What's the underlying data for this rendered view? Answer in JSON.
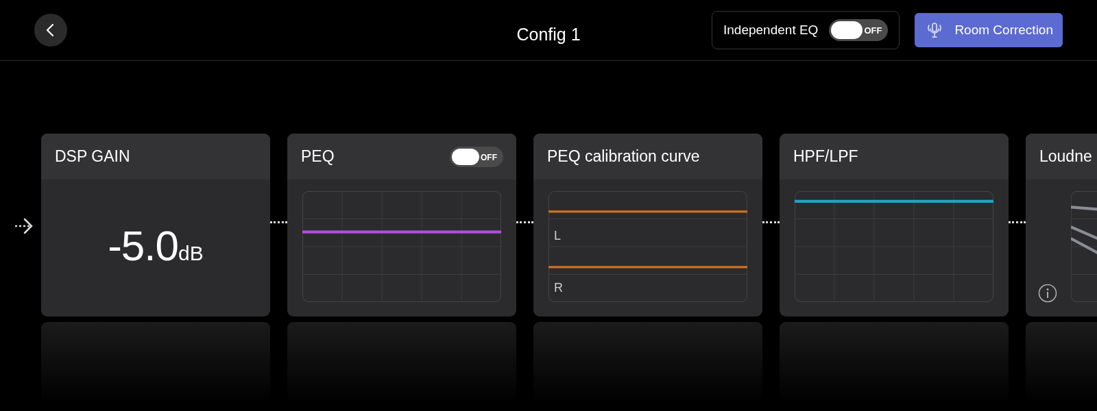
{
  "header": {
    "title": "Config 1",
    "independent_eq": {
      "label": "Independent EQ",
      "on": false,
      "state_text": "OFF"
    },
    "room_correction": {
      "label": "Room Correction"
    }
  },
  "modules": [
    {
      "kind": "gain",
      "title": "DSP GAIN",
      "value": "-5.0",
      "unit": "dB"
    },
    {
      "kind": "peq",
      "title": "PEQ",
      "toggle": {
        "on": false,
        "state_text": "OFF"
      }
    },
    {
      "kind": "calibration",
      "title": "PEQ calibration curve",
      "channels": [
        "L",
        "R"
      ]
    },
    {
      "kind": "filter",
      "title": "HPF/LPF"
    },
    {
      "kind": "loudness",
      "title": "Loudne"
    }
  ]
}
